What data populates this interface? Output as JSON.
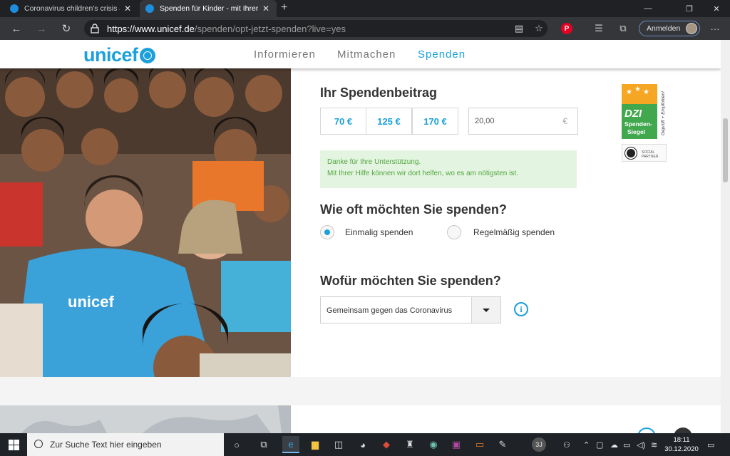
{
  "browser": {
    "tabs": [
      {
        "title": "Coronavirus children's crisis appe",
        "active": false
      },
      {
        "title": "Spenden für Kinder - mit Ihrer Sp",
        "active": true
      }
    ],
    "address": {
      "scheme_host": "https://www.unicef.de",
      "path": "/spenden/opt-jetzt-spenden?live=yes"
    },
    "signin_label": "Anmelden"
  },
  "site": {
    "logo": "unicef",
    "nav": [
      "Informieren",
      "Mitmachen",
      "Spenden"
    ],
    "active_nav": "Spenden"
  },
  "donation": {
    "amount_heading": "Ihr Spendenbeitrag",
    "amounts": [
      "70 €",
      "125 €",
      "170 €"
    ],
    "custom_amount": "20,00",
    "currency_symbol": "€",
    "thanks_line1": "Danke für Ihre Unterstützung.",
    "thanks_line2": "Mit Ihrer Hilfe können wir dort helfen, wo es am nötigsten ist.",
    "frequency_heading": "Wie oft möchten Sie spenden?",
    "frequency_options": [
      "Einmalig spenden",
      "Regelmäßig spenden"
    ],
    "frequency_selected": "Einmalig spenden",
    "purpose_heading": "Wofür möchten Sie spenden?",
    "purpose_selected": "Gemeinsam gegen das Coronavirus",
    "info_glyph": "i"
  },
  "badges": {
    "dzi_title": "DZI",
    "dzi_line1": "Spenden-",
    "dzi_line2": "Siegel",
    "dzi_side": "Geprüft + Empfohlen!",
    "social_line1": "SOCIAL",
    "social_line2": "PARTNER"
  },
  "photo": {
    "shirt_text": "unicef"
  },
  "taskbar": {
    "search_placeholder": "Zur Suche Text hier eingeben",
    "time": "18:11",
    "date": "30.12.2020",
    "user_initials": "3J"
  },
  "colors": {
    "unicef_blue": "#1ca0db",
    "success_bg": "#e3f4e1",
    "success_text": "#53a63f"
  }
}
